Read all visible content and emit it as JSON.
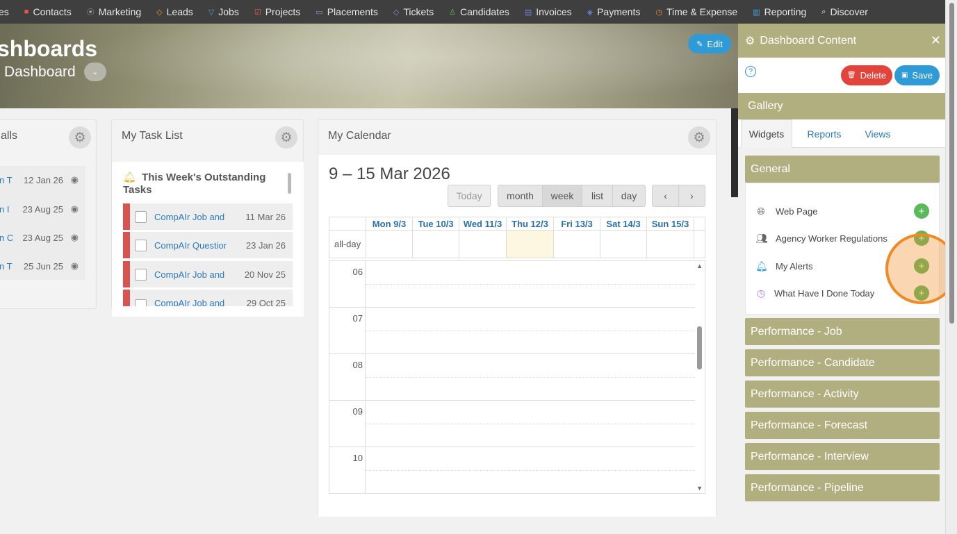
{
  "nav": {
    "items": [
      {
        "label": "es",
        "icon": "",
        "color": "#e8e8e8"
      },
      {
        "label": "Contacts",
        "icon": "contacts-icon",
        "color": "#e25a4f"
      },
      {
        "label": "Marketing",
        "icon": "marketing-icon",
        "color": "#a9a9a9"
      },
      {
        "label": "Leads",
        "icon": "leads-icon",
        "color": "#e3a02a"
      },
      {
        "label": "Jobs",
        "icon": "jobs-icon",
        "color": "#4aa3df"
      },
      {
        "label": "Projects",
        "icon": "projects-icon",
        "color": "#e25a4f"
      },
      {
        "label": "Placements",
        "icon": "placements-icon",
        "color": "#a77ed8"
      },
      {
        "label": "Tickets",
        "icon": "tickets-icon",
        "color": "#a77ed8"
      },
      {
        "label": "Candidates",
        "icon": "candidates-icon",
        "color": "#5cb85c"
      },
      {
        "label": "Invoices",
        "icon": "invoices-icon",
        "color": "#6f7fd8"
      },
      {
        "label": "Payments",
        "icon": "payments-icon",
        "color": "#6f7fd8"
      },
      {
        "label": "Time & Expense",
        "icon": "clock-icon",
        "color": "#e38a2a"
      },
      {
        "label": "Reporting",
        "icon": "reporting-icon",
        "color": "#4aa3df"
      },
      {
        "label": "Discover",
        "icon": "search-icon",
        "color": "#ffffff"
      }
    ]
  },
  "banner": {
    "title": "shboards",
    "subtitle": "Dashboard",
    "edit_label": "Edit"
  },
  "calls_panel": {
    "title": "alls",
    "rows": [
      {
        "link": "n T",
        "date": "12 Jan 26"
      },
      {
        "link": "n I",
        "date": "23 Aug 25"
      },
      {
        "link": "n C",
        "date": "23 Aug 25"
      },
      {
        "link": "n T",
        "date": "25 Jun 25"
      }
    ]
  },
  "task_panel": {
    "title": "My Task List",
    "heading": "This Week's Outstanding Tasks",
    "tasks": [
      {
        "label": "CompAIr Job and",
        "date": "11 Mar 26"
      },
      {
        "label": "CompAIr Questior",
        "date": "23 Jan 26"
      },
      {
        "label": "CompAIr Job and",
        "date": "20 Nov 25"
      },
      {
        "label": "CompAIr Job and",
        "date": "29 Oct 25"
      }
    ]
  },
  "calendar_panel": {
    "title": "My Calendar",
    "range": "9 – 15 Mar 2026",
    "today_label": "Today",
    "views": [
      "month",
      "week",
      "list",
      "day"
    ],
    "prev_label": "‹",
    "next_label": "›",
    "days": [
      "Mon 9/3",
      "Tue 10/3",
      "Wed 11/3",
      "Thu 12/3",
      "Fri 13/3",
      "Sat 14/3",
      "Sun 15/3"
    ],
    "allday_label": "all-day",
    "hours": [
      "06",
      "07",
      "08",
      "09",
      "10"
    ],
    "highlight_color": "#fdf6e0"
  },
  "side": {
    "title": "Dashboard Content",
    "delete_label": "Delete",
    "save_label": "Save",
    "gallery_label": "Gallery",
    "tabs": [
      "Widgets",
      "Reports",
      "Views"
    ],
    "general_label": "General",
    "widgets": [
      {
        "label": "Web Page",
        "icon": "globe-icon"
      },
      {
        "label": "Agency Worker Regulations",
        "icon": "users-icon"
      },
      {
        "label": "My Alerts",
        "icon": "bell-icon"
      },
      {
        "label": "What Have I Done Today",
        "icon": "clock-icon"
      }
    ],
    "sections": [
      "Performance - Job",
      "Performance - Candidate",
      "Performance - Activity",
      "Performance - Forecast",
      "Performance - Interview",
      "Performance - Pipeline"
    ],
    "accent_color": "#b1ae7f"
  }
}
